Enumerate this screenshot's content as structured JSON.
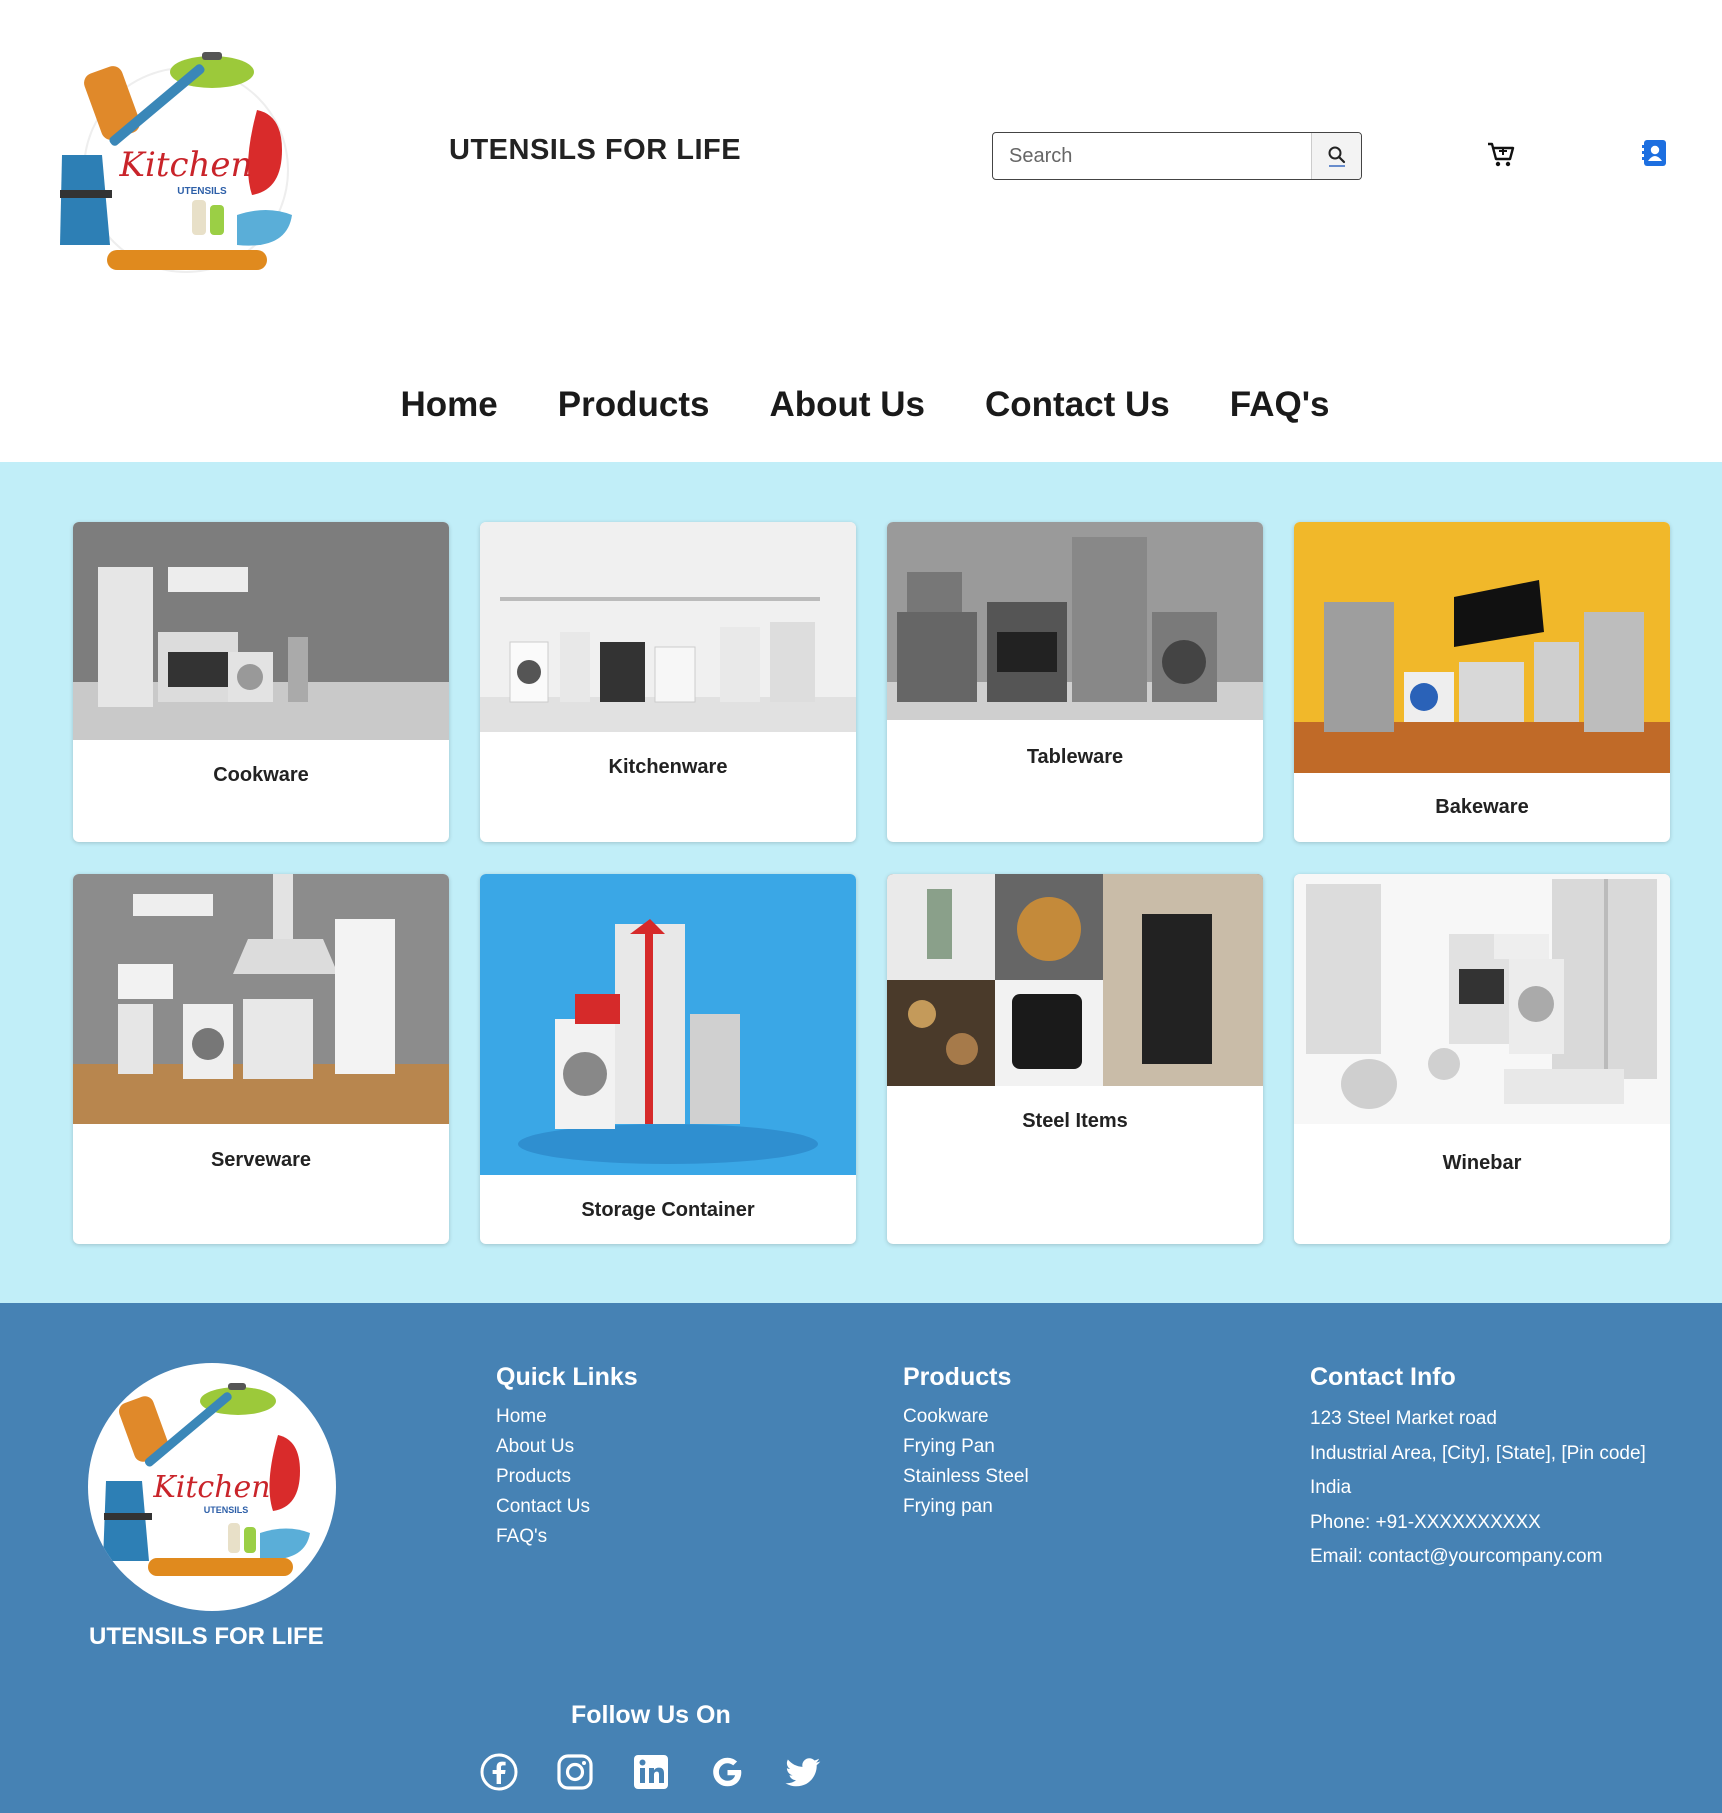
{
  "header": {
    "logo_text": "Kitchen",
    "logo_subtext": "UTENSILS",
    "site_title": "UTENSILS FOR LIFE",
    "search_placeholder": "Search"
  },
  "nav": [
    "Home",
    "Products",
    "About Us",
    "Contact Us",
    "FAQ's"
  ],
  "categories": [
    {
      "label": "Cookware"
    },
    {
      "label": "Kitchenware"
    },
    {
      "label": "Tableware"
    },
    {
      "label": "Bakeware"
    },
    {
      "label": "Serveware"
    },
    {
      "label": "Storage Container"
    },
    {
      "label": "Steel Items"
    },
    {
      "label": "Winebar"
    }
  ],
  "footer": {
    "brand": "UTENSILS FOR LIFE",
    "quick_links": {
      "title": "Quick Links",
      "items": [
        "Home",
        "About Us",
        "Products",
        "Contact Us",
        "FAQ's"
      ]
    },
    "products": {
      "title": "Products",
      "items": [
        "Cookware",
        "Frying Pan",
        "Stainless Steel",
        "Frying pan"
      ]
    },
    "contact": {
      "title": "Contact Info",
      "lines": [
        "123 Steel Market road",
        "Industrial Area, [City], [State], [Pin code]",
        "India",
        "Phone: +91-XXXXXXXXXX",
        "Email: contact@yourcompany.com"
      ]
    },
    "follow_title": "Follow Us On",
    "social_icons": [
      "facebook-icon",
      "instagram-icon",
      "linkedin-icon",
      "google-icon",
      "twitter-icon"
    ]
  },
  "colors": {
    "main_bg": "#c1eef8",
    "footer_bg": "#4682b4",
    "account_icon": "#1d6fe0"
  }
}
